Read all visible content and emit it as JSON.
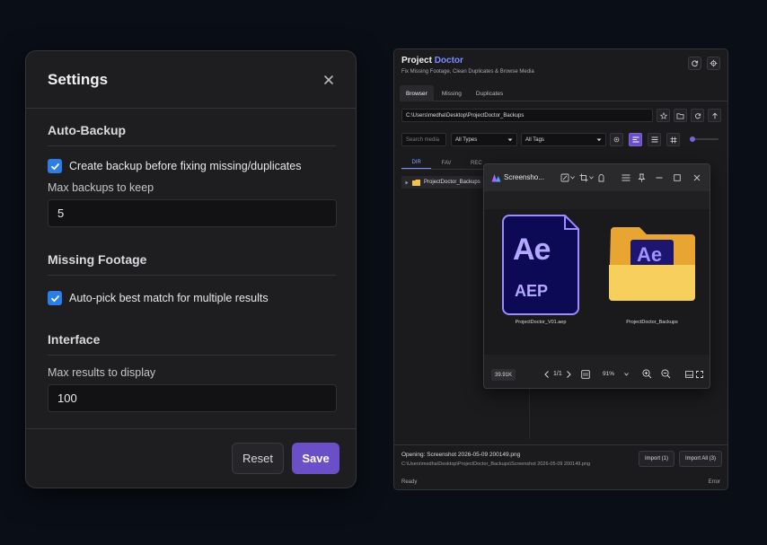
{
  "settings": {
    "title": "Settings",
    "sections": {
      "auto_backup": {
        "title": "Auto-Backup",
        "checkbox_label": "Create backup before fixing missing/duplicates",
        "checked": true,
        "field_label": "Max backups to keep",
        "field_value": "5"
      },
      "missing_footage": {
        "title": "Missing Footage",
        "checkbox_label": "Auto-pick best match for multiple results",
        "checked": true
      },
      "interface": {
        "title": "Interface",
        "field_label": "Max results to display",
        "field_value": "100"
      }
    },
    "reset_label": "Reset",
    "save_label": "Save"
  },
  "project_doctor": {
    "title_plain": "Project",
    "title_accent": "Doctor",
    "subtitle": "Fix Missing Footage, Clean Duplicates & Browse Media",
    "tabs": [
      "Browser",
      "Missing",
      "Duplicates"
    ],
    "path": "C:\\Users\\medha\\Desktop\\ProjectDoctor_Backups",
    "search_placeholder": "Search media",
    "type_filter": "All Types",
    "tag_filter": "All Tags",
    "side_tabs": [
      "DIR",
      "FAV",
      "REC"
    ],
    "tree_item": "ProjectDoctor_Backups",
    "opening_line": "Opening: Screenshot 2026-05-09 200149.png",
    "opening_path": "C:\\Users\\medha\\Desktop\\ProjectDoctor_Backups\\Screenshot 2026-05-09 200149.png",
    "import_label": "Import (1)",
    "import_all_label": "Import All (3)",
    "status_left": "Ready",
    "status_right": "Error",
    "accent_color": "#7b8cff"
  },
  "viewer": {
    "title": "Screensho...",
    "items": [
      {
        "label": "ProjectDoctor_V01.aep",
        "icon": "after-effects-file-icon",
        "icon_text_top": "Ae",
        "icon_text_bottom": "AEP"
      },
      {
        "label": "ProjectDoctor_Backups",
        "icon": "folder-icon",
        "icon_text_top": "Ae"
      }
    ],
    "size_badge": "39.91K",
    "page": "1/1",
    "zoom": "91%"
  }
}
